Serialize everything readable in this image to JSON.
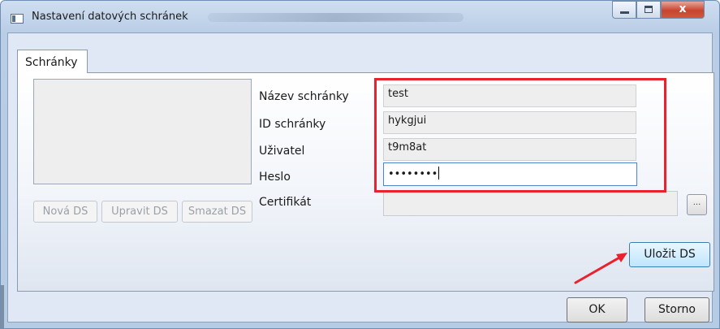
{
  "window": {
    "title": "Nastavení datových schránek",
    "controls": {
      "minimize": "minimize",
      "maximize": "maximize",
      "close": "x"
    }
  },
  "tabs": [
    {
      "label": "Schránky",
      "selected": true
    }
  ],
  "list_buttons": {
    "new": "Nová DS",
    "edit": "Upravit DS",
    "delete": "Smazat DS"
  },
  "form": {
    "name_label": "Název schránky",
    "name_value": "test",
    "id_label": "ID schránky",
    "id_value": "hykgjui",
    "user_label": "Uživatel",
    "user_value": "t9m8at",
    "password_label": "Heslo",
    "password_value": "••••••••",
    "certificate_label": "Certifikát",
    "certificate_value": "",
    "browse_label": "..."
  },
  "save_button": "Uložit DS",
  "footer": {
    "ok": "OK",
    "cancel": "Storno"
  },
  "colors": {
    "highlight": "#e8232f",
    "accent": "#3c7fb1"
  },
  "icons": {
    "window": "window-icon",
    "annotation": "red-arrow-icon"
  }
}
